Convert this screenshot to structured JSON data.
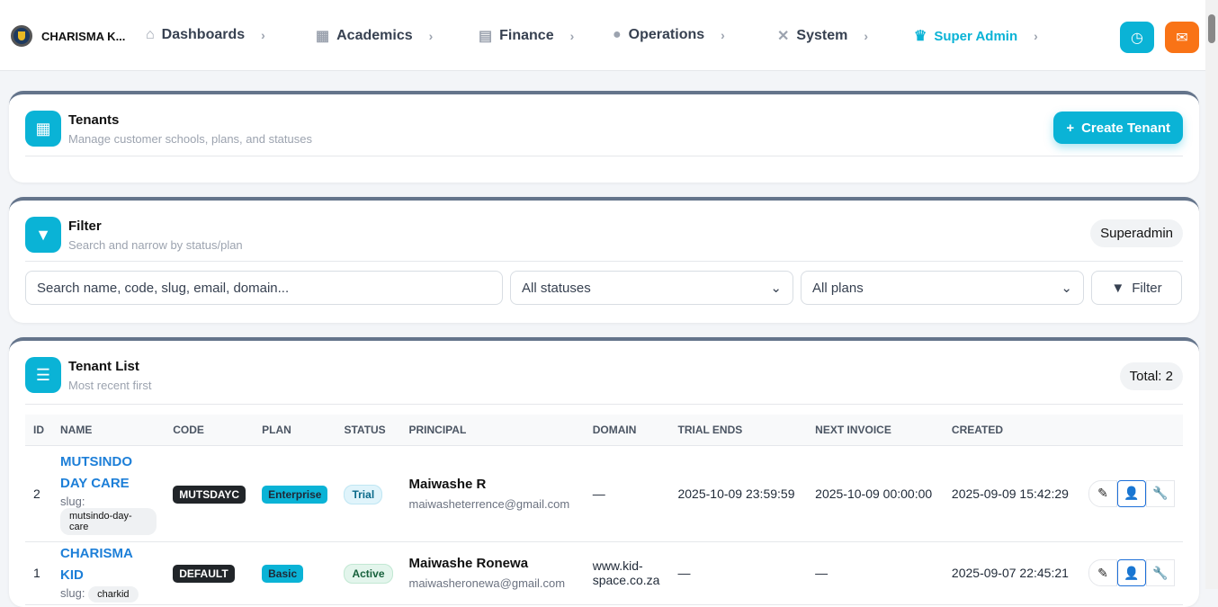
{
  "nav": {
    "brand": "CHARISMA K...",
    "items": [
      {
        "label": "Dashboards",
        "icon": "home-icon"
      },
      {
        "label": "Academics",
        "icon": "school-icon"
      },
      {
        "label": "Finance",
        "icon": "file-invoice-icon"
      },
      {
        "label": "Operations",
        "icon": "comments-icon"
      },
      {
        "label": "System",
        "icon": "tools-icon"
      },
      {
        "label": "Super Admin",
        "icon": "crown-icon"
      }
    ]
  },
  "tenants": {
    "title": "Tenants",
    "subtitle": "Manage customer schools, plans, and statuses",
    "create_label": "Create Tenant"
  },
  "filter": {
    "title": "Filter",
    "subtitle": "Search and narrow by status/plan",
    "badge": "Superadmin",
    "search_placeholder": "Search name, code, slug, email, domain...",
    "status_value": "All statuses",
    "plan_value": "All plans",
    "button": "Filter"
  },
  "list": {
    "title": "Tenant List",
    "subtitle": "Most recent first",
    "total": "Total: 2",
    "columns": [
      "ID",
      "NAME",
      "CODE",
      "PLAN",
      "STATUS",
      "PRINCIPAL",
      "DOMAIN",
      "TRIAL ENDS",
      "NEXT INVOICE",
      "CREATED"
    ],
    "slug_label": "slug:",
    "rows": [
      {
        "id": "2",
        "name": "MUTSINDO DAY CARE",
        "slug": "mutsindo-day-care",
        "code": "MUTSDAYC",
        "plan": "Enterprise",
        "status": "Trial",
        "principal": "Maiwashe R",
        "email": "maiwasheterrence@gmail.com",
        "domain": "—",
        "trial_ends": "2025-10-09 23:59:59",
        "next_invoice": "2025-10-09 00:00:00",
        "created": "2025-09-09 15:42:29"
      },
      {
        "id": "1",
        "name": "CHARISMA KID",
        "slug": "charkid",
        "code": "DEFAULT",
        "plan": "Basic",
        "status": "Active",
        "principal": "Maiwashe Ronewa",
        "email": "maiwasheronewa@gmail.com",
        "domain": "www.kid-space.co.za",
        "trial_ends": "—",
        "next_invoice": "—",
        "created": "2025-09-07 22:45:21"
      }
    ]
  },
  "colors": {
    "accent": "#0ab3d6",
    "orange": "#f97316"
  }
}
